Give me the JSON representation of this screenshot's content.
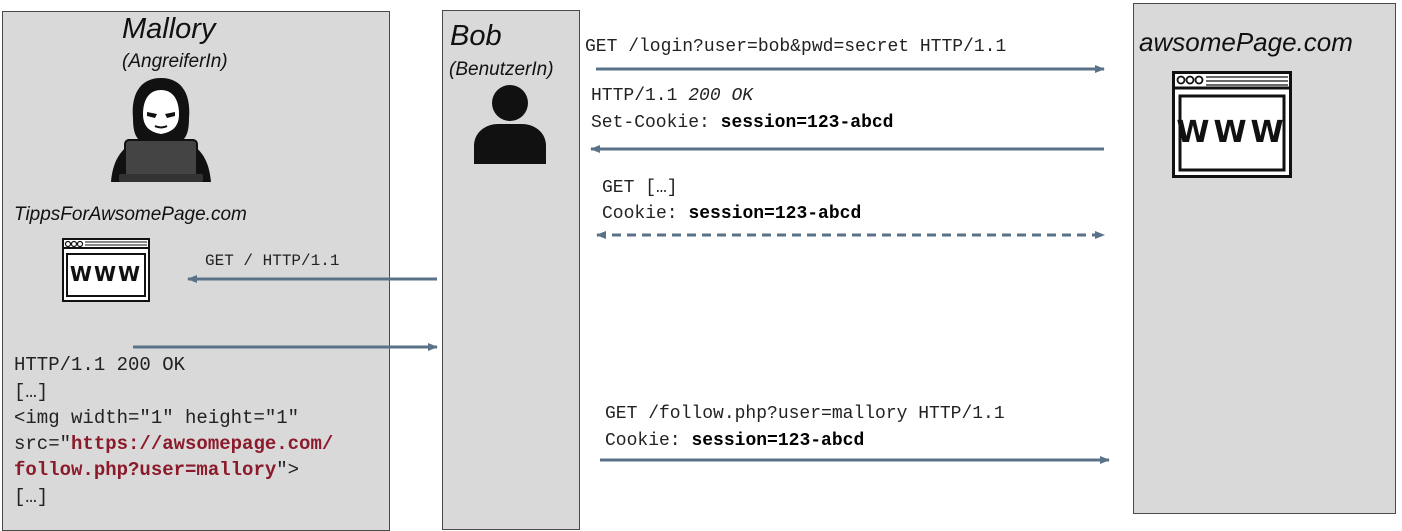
{
  "mallory": {
    "name": "Mallory",
    "role": "(AngreiferIn)",
    "site": "TippsForAwsomePage.com",
    "www": "WWW",
    "response": {
      "status": "HTTP/1.1 200 OK",
      "ellipsis1": "[…]",
      "img_tag_start": "<img width=\"1\" height=\"1\"",
      "src_prefix": "src=\"",
      "src_url_line1": "https://awsomepage.com/",
      "src_url_line2": "follow.php?user=mallory",
      "src_suffix": "\">",
      "ellipsis2": "[…]"
    }
  },
  "bob": {
    "name": "Bob",
    "role": "(BenutzerIn)"
  },
  "server": {
    "name": "awsomePage.com",
    "www": "WWW"
  },
  "messages": {
    "get_mallory": "GET / HTTP/1.1",
    "login_request": "GET /login?user=bob&pwd=secret HTTP/1.1",
    "login_response_proto": "HTTP/1.1",
    "login_response_status": "200 OK",
    "set_cookie_label": "Set-Cookie:",
    "set_cookie_value": "session=123-abcd",
    "get_generic": "GET […]",
    "cookie_label": "Cookie:",
    "cookie_value": "session=123-abcd",
    "follow_request": "GET /follow.php?user=mallory HTTP/1.1",
    "follow_cookie_label": "Cookie:",
    "follow_cookie_value": "session=123-abcd"
  },
  "colors": {
    "box_fill": "#d9d9d9",
    "arrow": "#5a7287",
    "url_red": "#8b1a2b"
  }
}
